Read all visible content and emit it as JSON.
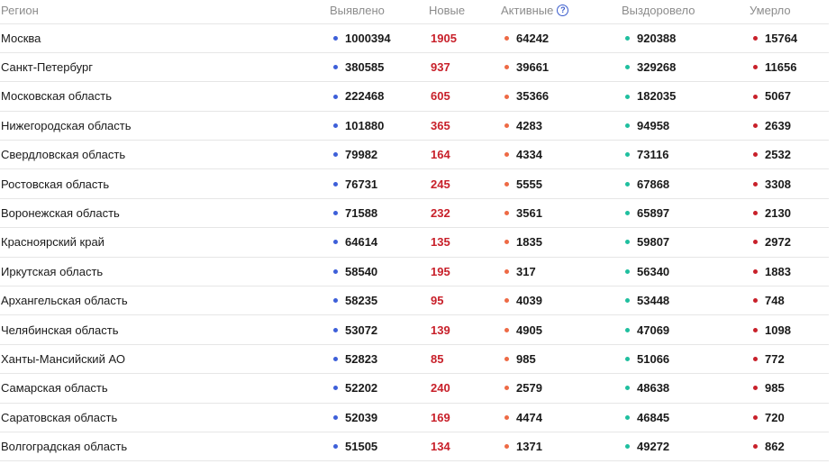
{
  "colors": {
    "detected": "#3d5fd9",
    "new": "#c8202a",
    "active": "#ee6a45",
    "recovered": "#1fbf9f",
    "died": "#c8202a"
  },
  "headers": {
    "region": "Регион",
    "detected": "Выявлено",
    "new": "Новые",
    "active": "Активные",
    "recovered": "Выздоровело",
    "died": "Умерло"
  },
  "help_icon": {
    "symbol": "?",
    "icon": "question-circle-icon"
  },
  "rows": [
    {
      "region": "Москва",
      "detected": "1000394",
      "new": "1905",
      "active": "64242",
      "recovered": "920388",
      "died": "15764"
    },
    {
      "region": "Санкт-Петербург",
      "detected": "380585",
      "new": "937",
      "active": "39661",
      "recovered": "329268",
      "died": "11656"
    },
    {
      "region": "Московская область",
      "detected": "222468",
      "new": "605",
      "active": "35366",
      "recovered": "182035",
      "died": "5067"
    },
    {
      "region": "Нижегородская область",
      "detected": "101880",
      "new": "365",
      "active": "4283",
      "recovered": "94958",
      "died": "2639"
    },
    {
      "region": "Свердловская область",
      "detected": "79982",
      "new": "164",
      "active": "4334",
      "recovered": "73116",
      "died": "2532"
    },
    {
      "region": "Ростовская область",
      "detected": "76731",
      "new": "245",
      "active": "5555",
      "recovered": "67868",
      "died": "3308"
    },
    {
      "region": "Воронежская область",
      "detected": "71588",
      "new": "232",
      "active": "3561",
      "recovered": "65897",
      "died": "2130"
    },
    {
      "region": "Красноярский край",
      "detected": "64614",
      "new": "135",
      "active": "1835",
      "recovered": "59807",
      "died": "2972"
    },
    {
      "region": "Иркутская область",
      "detected": "58540",
      "new": "195",
      "active": "317",
      "recovered": "56340",
      "died": "1883"
    },
    {
      "region": "Архангельская область",
      "detected": "58235",
      "new": "95",
      "active": "4039",
      "recovered": "53448",
      "died": "748"
    },
    {
      "region": "Челябинская область",
      "detected": "53072",
      "new": "139",
      "active": "4905",
      "recovered": "47069",
      "died": "1098"
    },
    {
      "region": "Ханты-Мансийский АО",
      "detected": "52823",
      "new": "85",
      "active": "985",
      "recovered": "51066",
      "died": "772"
    },
    {
      "region": "Самарская область",
      "detected": "52202",
      "new": "240",
      "active": "2579",
      "recovered": "48638",
      "died": "985"
    },
    {
      "region": "Саратовская область",
      "detected": "52039",
      "new": "169",
      "active": "4474",
      "recovered": "46845",
      "died": "720"
    },
    {
      "region": "Волгоградская область",
      "detected": "51505",
      "new": "134",
      "active": "1371",
      "recovered": "49272",
      "died": "862"
    }
  ]
}
